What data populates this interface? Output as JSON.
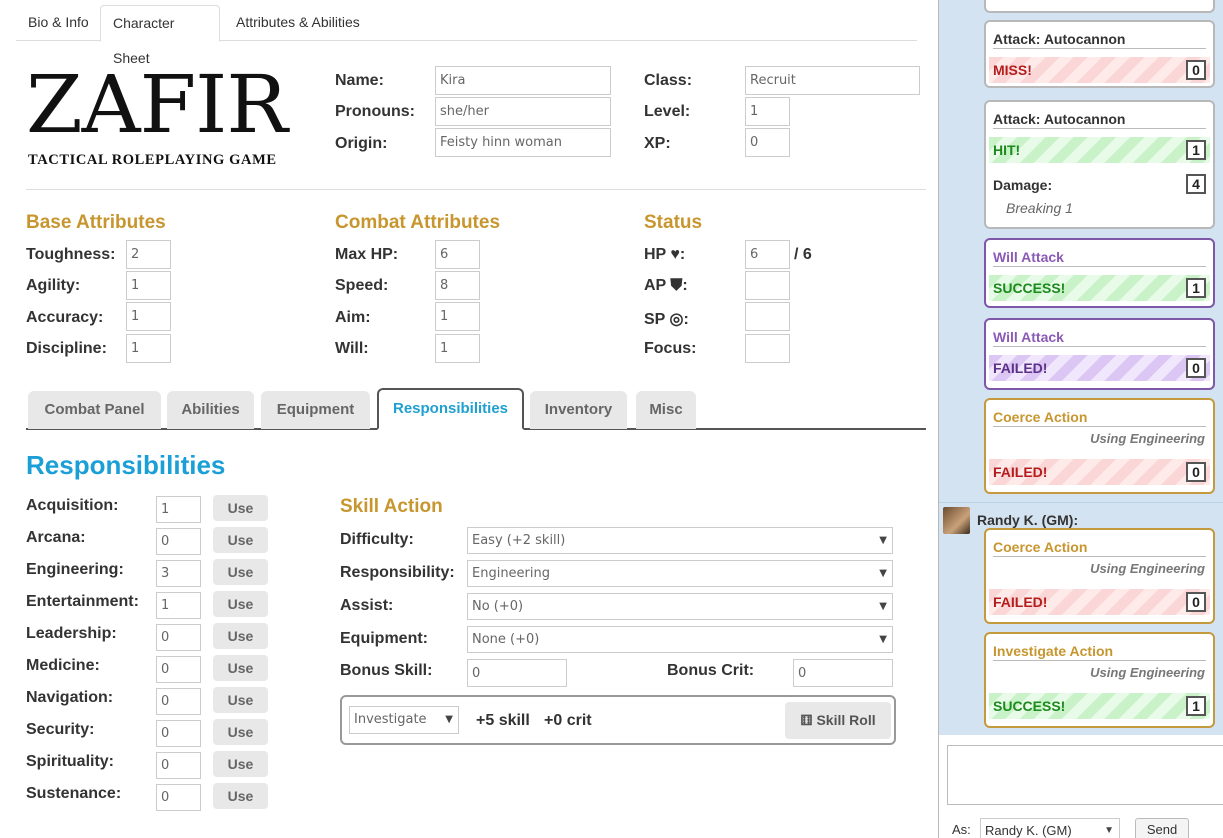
{
  "top_tabs": [
    "Bio & Info",
    "Character Sheet",
    "Attributes & Abilities"
  ],
  "logo": {
    "main": "ZAFIR",
    "sub": "TACTICAL ROLEPLAYING GAME"
  },
  "bio": {
    "name_label": "Name:",
    "name": "Kira",
    "pronouns_label": "Pronouns:",
    "pronouns": "she/her",
    "origin_label": "Origin:",
    "origin": "Feisty hinn woman",
    "class_label": "Class:",
    "class": "Recruit",
    "level_label": "Level:",
    "level": "1",
    "xp_label": "XP:",
    "xp": "0"
  },
  "base": {
    "title": "Base Attributes",
    "toughness_label": "Toughness:",
    "toughness": "2",
    "agility_label": "Agility:",
    "agility": "1",
    "accuracy_label": "Accuracy:",
    "accuracy": "1",
    "discipline_label": "Discipline:",
    "discipline": "1"
  },
  "combat": {
    "title": "Combat Attributes",
    "maxhp_label": "Max HP:",
    "maxhp": "6",
    "speed_label": "Speed:",
    "speed": "8",
    "aim_label": "Aim:",
    "aim": "1",
    "will_label": "Will:",
    "will": "1"
  },
  "status": {
    "title": "Status",
    "hp_label": "HP ♥:",
    "hp": "6",
    "hp_max": "/ 6",
    "ap_label": "AP ⛊:",
    "ap": "",
    "sp_label": "SP ◎:",
    "sp": "",
    "focus_label": "Focus:",
    "focus": ""
  },
  "sheet_tabs": [
    "Combat Panel",
    "Abilities",
    "Equipment",
    "Responsibilities",
    "Inventory",
    "Misc"
  ],
  "responsibilities": {
    "title": "Responsibilities",
    "use_label": "Use",
    "items": [
      {
        "label": "Acquisition:",
        "value": "1"
      },
      {
        "label": "Arcana:",
        "value": "0"
      },
      {
        "label": "Engineering:",
        "value": "3"
      },
      {
        "label": "Entertainment:",
        "value": "1"
      },
      {
        "label": "Leadership:",
        "value": "0"
      },
      {
        "label": "Medicine:",
        "value": "0"
      },
      {
        "label": "Navigation:",
        "value": "0"
      },
      {
        "label": "Security:",
        "value": "0"
      },
      {
        "label": "Spirituality:",
        "value": "0"
      },
      {
        "label": "Sustenance:",
        "value": "0"
      }
    ]
  },
  "skill_action": {
    "title": "Skill Action",
    "difficulty_label": "Difficulty:",
    "difficulty": "Easy (+2 skill)",
    "responsibility_label": "Responsibility:",
    "responsibility": "Engineering",
    "assist_label": "Assist:",
    "assist": "No (+0)",
    "equipment_label": "Equipment:",
    "equipment": "None (+0)",
    "bonus_skill_label": "Bonus Skill:",
    "bonus_skill": "0",
    "bonus_crit_label": "Bonus Crit:",
    "bonus_crit": "0",
    "action_select": "Investigate",
    "skill_total": "+5 skill",
    "crit_total": "+0 crit",
    "roll_button": "Skill Roll"
  },
  "chat": {
    "messages": [
      {
        "title": "Attack: Autocannon",
        "result": "MISS!",
        "value": "0"
      },
      {
        "title": "Attack: Autocannon",
        "result": "HIT!",
        "value": "1",
        "damage_label": "Damage:",
        "damage_value": "4",
        "damage_note": "Breaking 1"
      },
      {
        "title": "Will Attack",
        "result": "SUCCESS!",
        "value": "1"
      },
      {
        "title": "Will Attack",
        "result": "FAILED!",
        "value": "0"
      },
      {
        "title": "Coerce Action",
        "subtitle": "Using Engineering",
        "result": "FAILED!",
        "value": "0"
      },
      {
        "title": "Coerce Action",
        "subtitle": "Using Engineering",
        "result": "FAILED!",
        "value": "0"
      },
      {
        "title": "Investigate Action",
        "subtitle": "Using Engineering",
        "result": "SUCCESS!",
        "value": "1"
      }
    ],
    "speaker": "Randy K. (GM):",
    "as_label": "As:",
    "as_value": "Randy K. (GM)",
    "send_label": "Send"
  }
}
